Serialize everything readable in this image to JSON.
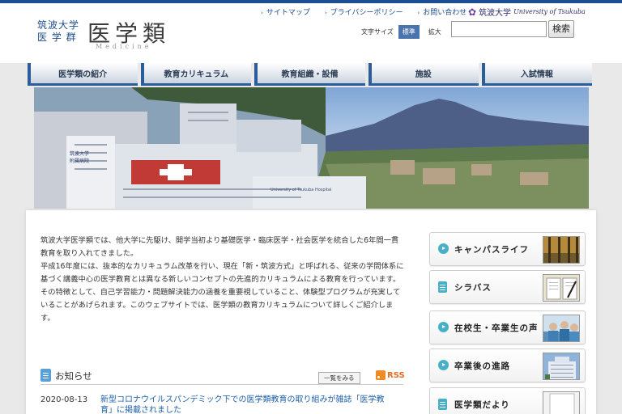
{
  "header": {
    "univ_line1": "筑波大学",
    "univ_line2": "医 学 群",
    "site_title": "医学類",
    "site_subtitle": "Medicine",
    "links": [
      "サイトマップ",
      "プライバシーポリシー",
      "お問い合わせ"
    ],
    "brand_jp": "筑波大学",
    "brand_en": "University of Tsukuba",
    "text_size_label": "文字サイズ",
    "text_size_options": [
      "標準",
      "拡大"
    ],
    "search_placeholder": "",
    "search_button": "検索"
  },
  "nav": [
    "医学類の紹介",
    "教育カリキュラム",
    "教育組織・設備",
    "施設",
    "入試情報"
  ],
  "hero": {
    "building_sign": "筑波大学\n附属病院",
    "hospital_sign": "University of Tsukuba Hospital"
  },
  "intro": [
    "筑波大学医学類では、他大学に先駆け、開学当初より基礎医学・臨床医学・社会医学を統合した6年間一貫教育を取り入れてきました。",
    "平成16年度には、抜本的なカリキュラム改革を行い、現在「新・筑波方式」と呼ばれる、従来の学問体系に基づく講義中心の医学教育とは異なる新しいコンセプトの先進的カリキュラムによる教育を行っています。",
    "その特徴として、自己学習能力・問題解決能力の涵養を重要視していること、体験型プログラムが充実していることがあげられます。このウェブサイトでは、医学類の教育カリキュラムについて詳しくご紹介します。"
  ],
  "news": {
    "title": "お知らせ",
    "all_label": "一覧をみる",
    "rss_label": "RSS",
    "items": [
      {
        "date": "2020-08-13",
        "text": "新型コロナウイルスパンデミック下での医学類教育の取り組みが雑誌「医学教育」に掲載されました"
      }
    ]
  },
  "side": [
    {
      "label": "キャンパスライフ",
      "icon": "arrow"
    },
    {
      "label": "シラバス",
      "icon": "doc"
    },
    {
      "label": "在校生・卒業生の声",
      "icon": "arrow"
    },
    {
      "label": "卒業後の進路",
      "icon": "arrow"
    },
    {
      "label": "医学類だより",
      "icon": "doc"
    }
  ],
  "colors": {
    "accent": "#1d4d8d",
    "nav_bar": "#2c5d9b",
    "link": "#1d5fa8"
  }
}
